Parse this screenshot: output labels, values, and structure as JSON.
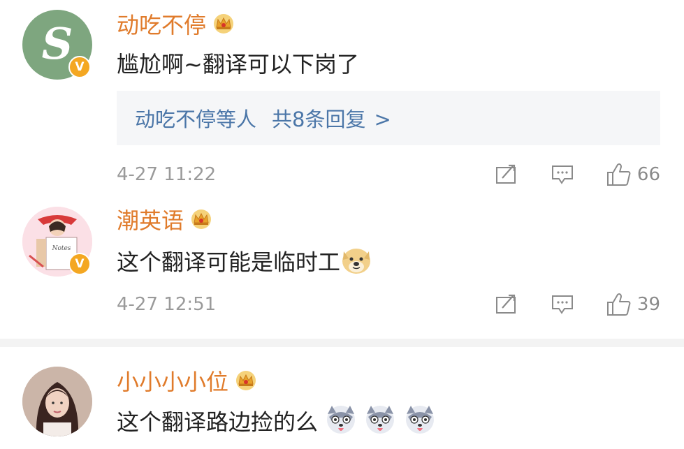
{
  "comments": [
    {
      "user": "动吃不停",
      "text": "尴尬啊~翻译可以下岗了",
      "replies_name": "动吃不停等人",
      "replies_count": "共8条回复",
      "replies_arrow": ">",
      "time": "4-27 11:22",
      "likes": "66"
    },
    {
      "user": "潮英语",
      "text": "这个翻译可能是临时工",
      "time": "4-27 12:51",
      "likes": "39"
    },
    {
      "user": "小小小小位",
      "text": "这个翻译路边捡的么"
    }
  ],
  "avatar1_letter": "S",
  "avatar2_book": "Notes",
  "badge_letter": "V",
  "icons": {
    "crown": "crown-icon",
    "verified": "verified-badge-icon",
    "repost": "repost-icon",
    "comment": "comment-icon",
    "like": "like-icon",
    "doge": "doge-emoji",
    "husky": "husky-tongue-emoji"
  },
  "colors": {
    "username": "#e07b2b",
    "reply_link": "#4b76a8",
    "meta": "#9a9a9a",
    "reply_bg": "#f5f6f8"
  }
}
